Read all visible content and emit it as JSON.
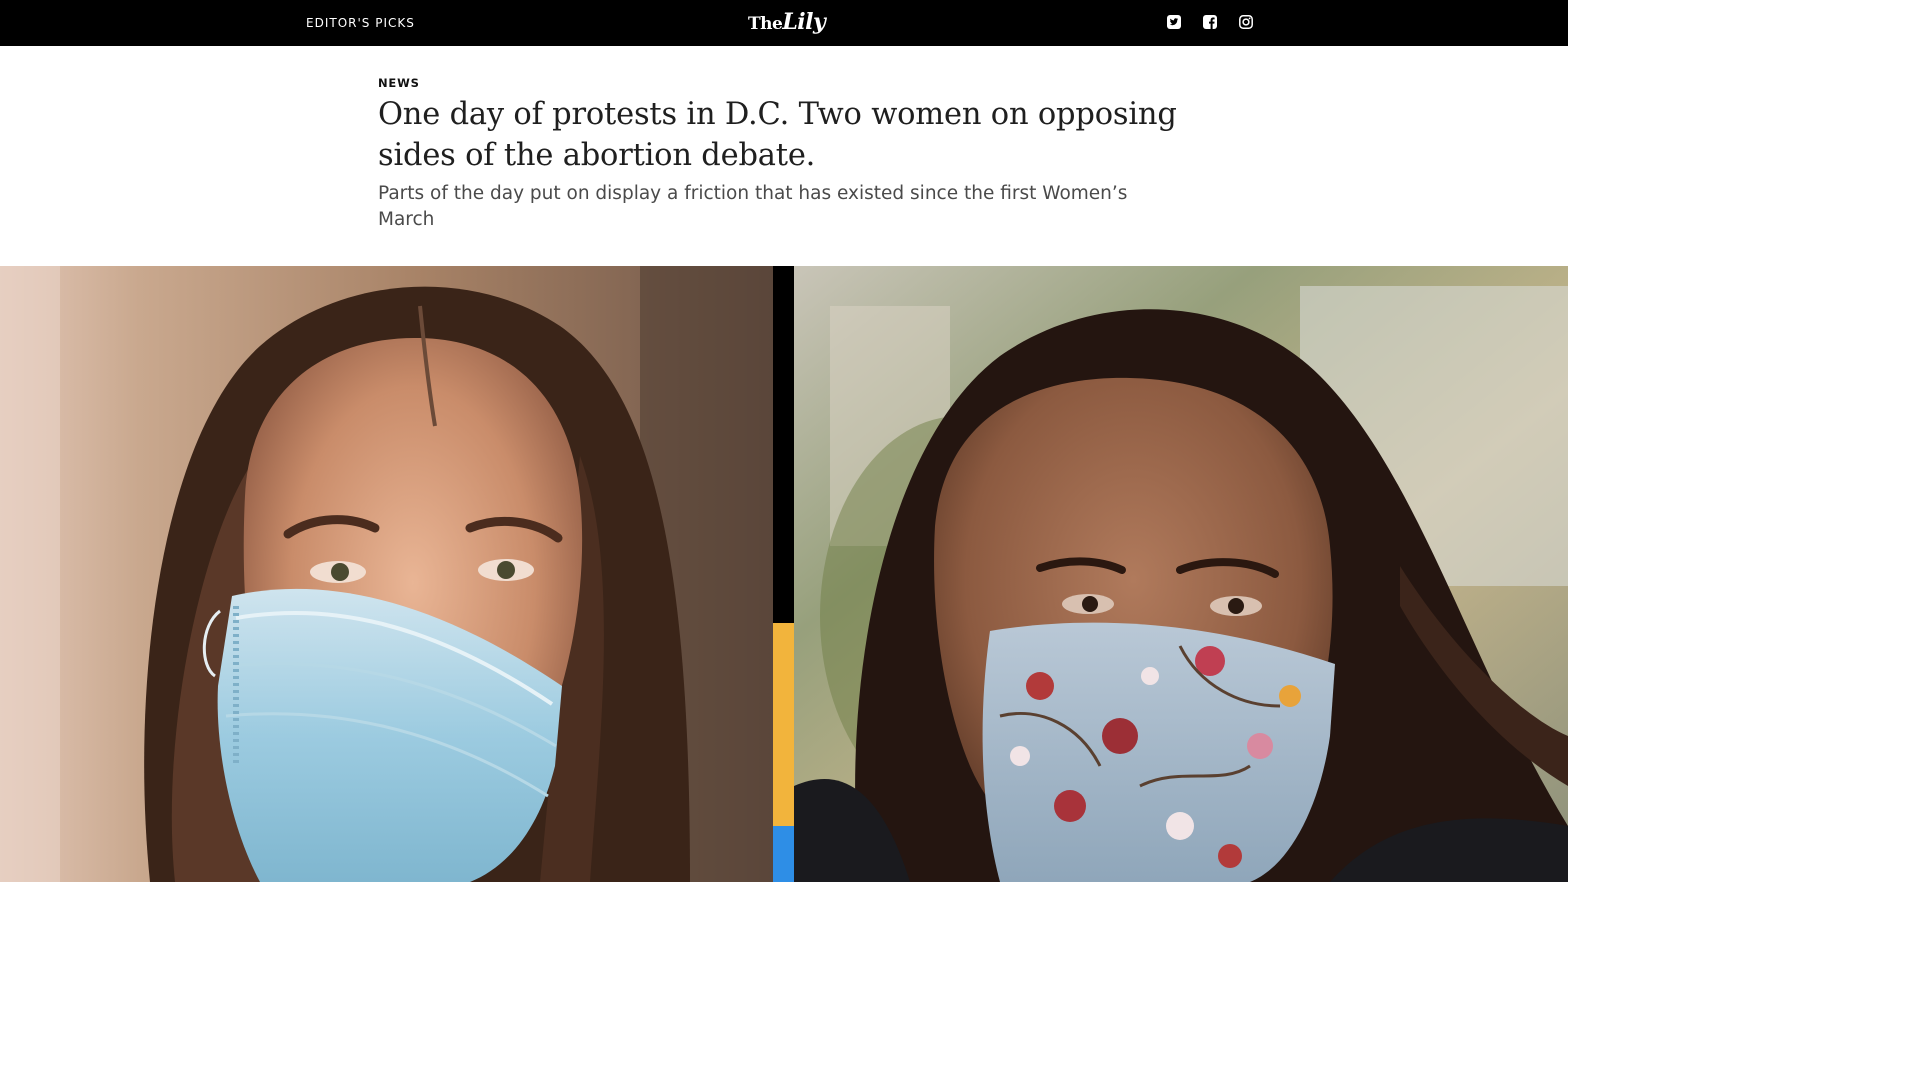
{
  "nav": {
    "section_link": "EDITOR'S PICKS",
    "logo": {
      "the": "The",
      "lily": "Lily"
    },
    "social": [
      {
        "icon": "twitter-icon"
      },
      {
        "icon": "facebook-icon"
      },
      {
        "icon": "instagram-icon"
      }
    ]
  },
  "article": {
    "category": "NEWS",
    "headline": "One day of protests in D.C. Two women on opposing sides of the abortion debate.",
    "dek": "Parts of the day put on display a friction that has existed since the first Women’s March"
  },
  "hero": {
    "divider_colors": [
      "#000000",
      "#f2b43c",
      "#2e8ee6"
    ]
  },
  "colors": {
    "topbar": "#000000",
    "text_primary": "#1f1f1f",
    "text_secondary": "#4a4a4a"
  }
}
